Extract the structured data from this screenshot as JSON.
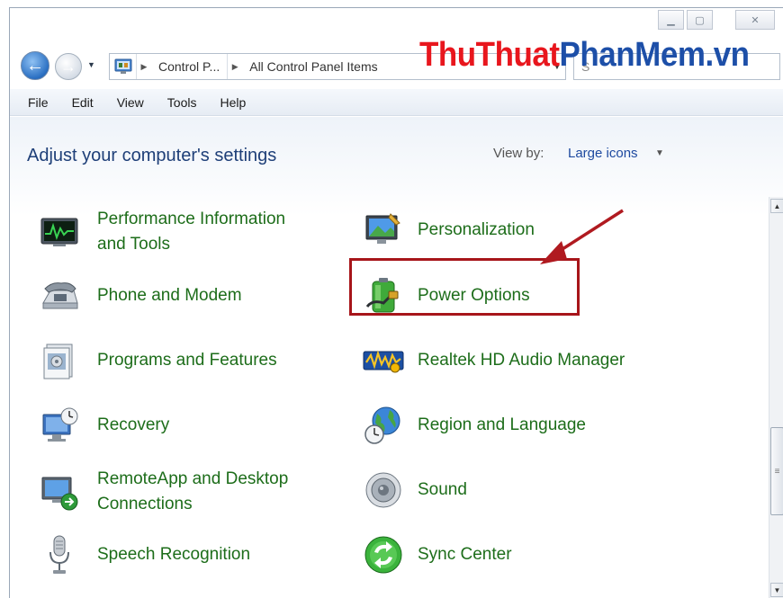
{
  "window": {
    "caption_buttons": {
      "minimize": "▁",
      "maximize": "▢",
      "close": "✕"
    }
  },
  "address_bar": {
    "breadcrumbs": [
      "Control P...",
      "All Control Panel Items"
    ],
    "search_placeholder": "S"
  },
  "watermark": {
    "part1": "ThuThuat",
    "part2": "PhanMem.vn"
  },
  "menu": [
    "File",
    "Edit",
    "View",
    "Tools",
    "Help"
  ],
  "header": {
    "title": "Adjust your computer's settings",
    "view_by_label": "View by:",
    "view_by_value": "Large icons"
  },
  "items_left": [
    {
      "label": "Performance Information and Tools",
      "line1": "Performance Information",
      "line2": "and Tools",
      "icon": "performance-icon"
    },
    {
      "label": "Phone and Modem",
      "icon": "phone-modem-icon"
    },
    {
      "label": "Programs and Features",
      "icon": "programs-features-icon"
    },
    {
      "label": "Recovery",
      "icon": "recovery-icon"
    },
    {
      "label": "RemoteApp and Desktop Connections",
      "line1": "RemoteApp and Desktop",
      "line2": "Connections",
      "icon": "remoteapp-icon"
    },
    {
      "label": "Speech Recognition",
      "icon": "microphone-icon"
    }
  ],
  "items_right": [
    {
      "label": "Personalization",
      "icon": "personalization-icon"
    },
    {
      "label": "Power Options",
      "icon": "power-options-icon"
    },
    {
      "label": "Realtek HD Audio Manager",
      "icon": "audio-manager-icon"
    },
    {
      "label": "Region and Language",
      "icon": "globe-clock-icon"
    },
    {
      "label": "Sound",
      "icon": "speaker-icon"
    },
    {
      "label": "Sync Center",
      "icon": "sync-icon"
    }
  ],
  "colors": {
    "link_green": "#1d6d1a",
    "title_blue": "#1e3f78",
    "highlight_red": "#a7151a"
  }
}
